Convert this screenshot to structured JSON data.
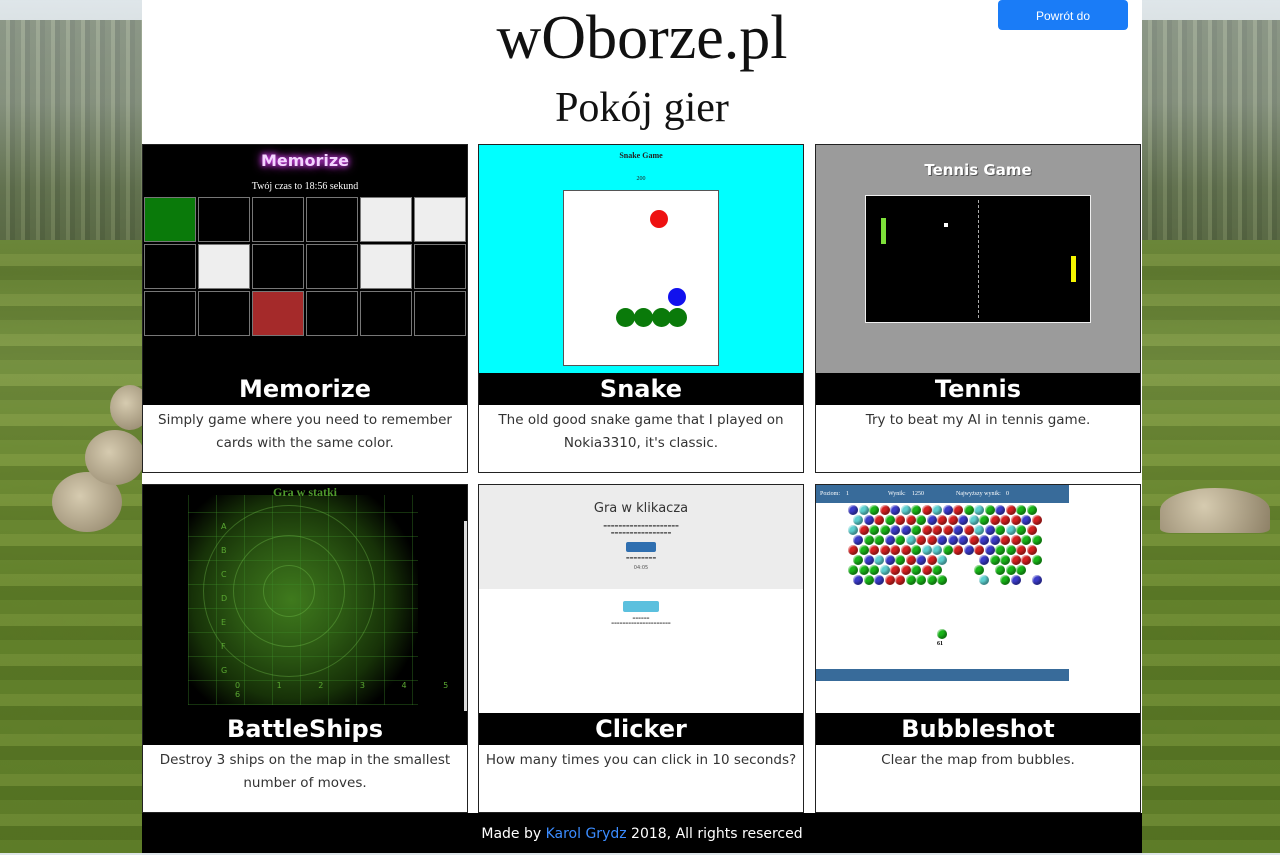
{
  "header": {
    "site_title": "wOborze.pl",
    "subtitle": "Pokój gier",
    "back_button": "Powrót do wOborze.pl"
  },
  "games": [
    {
      "title": "Memorize",
      "description": "Simply game where you need to remember cards with the same color."
    },
    {
      "title": "Snake",
      "description": "The old good snake game that I played on Nokia3310, it's classic."
    },
    {
      "title": "Tennis",
      "description": "Try to beat my AI in tennis game."
    },
    {
      "title": "BattleShips",
      "description": "Destroy 3 ships on the map in the smallest number of moves."
    },
    {
      "title": "Clicker",
      "description": "How many times you can click in 10 seconds?"
    },
    {
      "title": "Bubbleshot",
      "description": "Clear the map from bubbles."
    }
  ],
  "thumbnails": {
    "memorize": {
      "title": "Memorize",
      "time_text": "Twój czas to 18:56 sekund"
    },
    "snake": {
      "title": "Snake Game",
      "score": "200"
    },
    "tennis": {
      "title": "Tennis Game"
    },
    "battleships": {
      "title": "Gra w statki",
      "letters": "A B C D E F G",
      "numbers": "0 1 2 3 4 5 6"
    },
    "clicker": {
      "title": "Gra w klikacza",
      "time": "04:05"
    },
    "bubbleshot": {
      "level_label": "Poziom:",
      "level": "1",
      "score_label": "Wynik:",
      "score": "1250",
      "best_label": "Najwyższy wynik:",
      "best": "0",
      "next": "61"
    }
  },
  "footer": {
    "prefix": "Made by ",
    "author": "Karol Grydz",
    "suffix": " 2018, All rights reserced"
  },
  "colors": {
    "accent": "#1a7cf7",
    "title_bar": "#000000",
    "link": "#3b8cff"
  }
}
